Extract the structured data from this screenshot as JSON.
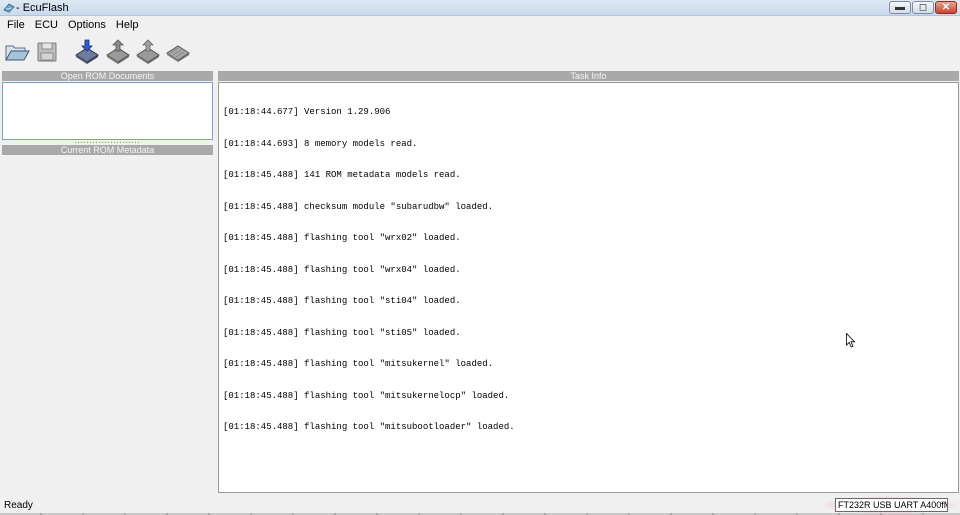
{
  "window": {
    "title": "- EcuFlash",
    "icons": {
      "app": "ecuflash-app-icon",
      "minimize": "minimize-icon",
      "maximize": "maximize-icon",
      "close": "close-icon"
    }
  },
  "menu": [
    {
      "id": "file",
      "label": "File"
    },
    {
      "id": "ecu",
      "label": "ECU"
    },
    {
      "id": "options",
      "label": "Options"
    },
    {
      "id": "help",
      "label": "Help"
    }
  ],
  "toolbar": [
    {
      "id": "open",
      "icon": "open-folder-icon"
    },
    {
      "id": "save",
      "icon": "save-disk-icon"
    },
    {
      "id": "read",
      "icon": "read-ecu-chip-icon"
    },
    {
      "id": "write",
      "icon": "write-ecu-chip-icon"
    },
    {
      "id": "test-write",
      "icon": "test-write-chip-icon"
    },
    {
      "id": "compare",
      "icon": "compare-chip-icon"
    }
  ],
  "left_panel": {
    "open_rom_documents": "Open ROM Documents",
    "current_rom_metadata": "Current ROM Metadata"
  },
  "task_info": {
    "title": "Task Info",
    "log": [
      "[01:18:44.677] Version 1.29.906",
      "[01:18:44.693] 8 memory models read.",
      "[01:18:45.488] 141 ROM metadata models read.",
      "[01:18:45.488] checksum module \"subarudbw\" loaded.",
      "[01:18:45.488] flashing tool \"wrx02\" loaded.",
      "[01:18:45.488] flashing tool \"wrx04\" loaded.",
      "[01:18:45.488] flashing tool \"sti04\" loaded.",
      "[01:18:45.488] flashing tool \"sti05\" loaded.",
      "[01:18:45.488] flashing tool \"mitsukernel\" loaded.",
      "[01:18:45.488] flashing tool \"mitsukernelocp\" loaded.",
      "[01:18:45.488] flashing tool \"mitsubootloader\" loaded."
    ]
  },
  "status": {
    "text": "Ready",
    "device": "FT232R USB UART A400fMIA"
  },
  "colors": {
    "panel_header": "#a9a9a9",
    "selection_border": "#7aa0d2",
    "highlight": "#f096a0"
  }
}
